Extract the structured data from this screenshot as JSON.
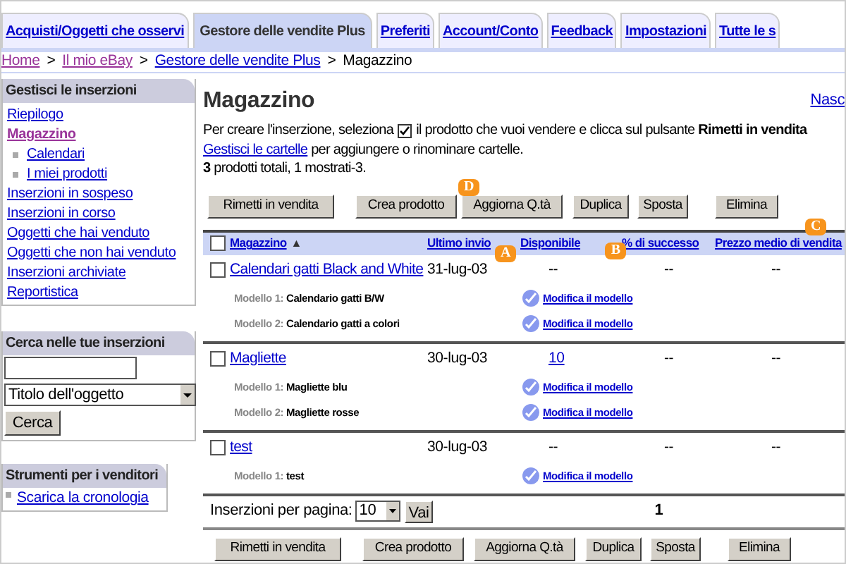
{
  "tabs": [
    {
      "label": "Acquisti/Oggetti che osservi",
      "selected": false
    },
    {
      "label": "Gestore delle vendite Plus",
      "selected": true
    },
    {
      "label": "Preferiti",
      "selected": false
    },
    {
      "label": "Account/Conto",
      "selected": false
    },
    {
      "label": "Feedback",
      "selected": false
    },
    {
      "label": "Impostazioni",
      "selected": false
    },
    {
      "label": "Tutte le s",
      "selected": false
    }
  ],
  "breadcrumb": {
    "links": [
      "Home",
      "Il mio eBay",
      "Gestore delle vendite Plus"
    ],
    "current": "Magazzino",
    "separator": ">"
  },
  "sidebar": {
    "manage": {
      "title": "Gestisci le inserzioni",
      "items": [
        {
          "label": "Riepilogo",
          "selected": false
        },
        {
          "label": "Magazzino",
          "selected": true,
          "children": [
            {
              "label": "Calendari",
              "selected": false
            },
            {
              "label": "I miei prodotti",
              "selected": false
            }
          ]
        },
        {
          "label": "Inserzioni in sospeso",
          "selected": false
        },
        {
          "label": "Inserzioni in corso",
          "selected": false
        },
        {
          "label": "Oggetti che hai venduto",
          "selected": false
        },
        {
          "label": "Oggetti che non hai venduto",
          "selected": false
        },
        {
          "label": "Inserzioni archiviate",
          "selected": false
        },
        {
          "label": "Reportistica",
          "selected": false
        }
      ]
    },
    "search": {
      "title": "Cerca nelle tue inserzioni",
      "select_value": "Titolo dell'oggetto",
      "button": "Cerca"
    },
    "tools": {
      "title": "Strumenti per i venditori",
      "items": [
        "Scarica la cronologia"
      ]
    }
  },
  "main": {
    "title": "Magazzino",
    "hide_link": "Nasc",
    "intro_start": "Per creare l'inserzione, seleziona",
    "intro_end": "il prodotto che vuoi vendere e clicca sul pulsante **Rimetti in vendita**",
    "folders_link": "Gestisci le cartelle",
    "folders_text": "per aggiungere o rinominare cartelle.",
    "count": "**3** prodotti totali, 1 mostrati-3.",
    "buttons": [
      {
        "label": "Rimetti in vendita"
      },
      {
        "label": "Crea prodotto"
      },
      {
        "label": "Aggiorna Q.tà",
        "callout": "D"
      },
      {
        "label": "Duplica"
      },
      {
        "label": "Sposta"
      },
      {
        "label": "Elimina"
      }
    ],
    "columns": [
      {
        "label": "Magazzino",
        "sort_icon": "▲"
      },
      {
        "label": "Ultimo invio",
        "callout": "A"
      },
      {
        "label": "Disponibile"
      },
      {
        "label": "% di successo",
        "callout": "B"
      },
      {
        "label": "Prezzo medio di vendita",
        "callout": "C"
      }
    ],
    "header_checked": false,
    "products": [
      {
        "name": "Calendari gatti Black and White",
        "checked": false,
        "date": "31-lug-03",
        "available": {
          "text": "--",
          "link": false
        },
        "success": "--",
        "price": "--",
        "models": [
          {
            "label": "Modello 1:",
            "name": "Calendario gatti B/W",
            "action": "Modifica il modello"
          },
          {
            "label": "Modello 2:",
            "name": "Calendario gatti a colori",
            "action": "Modifica il modello"
          }
        ]
      },
      {
        "name": "Magliette",
        "checked": false,
        "date": "30-lug-03",
        "available": {
          "text": "10",
          "link": true
        },
        "success": "--",
        "price": "--",
        "models": [
          {
            "label": "Modello 1:",
            "name": "Magliette blu",
            "action": "Modifica il modello"
          },
          {
            "label": "Modello 2:",
            "name": "Magliette rosse",
            "action": "Modifica il modello"
          }
        ]
      },
      {
        "name": "test",
        "checked": false,
        "date": "30-lug-03",
        "available": {
          "text": "--",
          "link": false
        },
        "success": "--",
        "price": "--",
        "models": [
          {
            "label": "Modello 1:",
            "name": "test",
            "action": "Modifica il modello"
          }
        ]
      }
    ],
    "per_page": {
      "label": "Inserzioni per pagina:",
      "value": "10",
      "button": "Vai",
      "page": "1"
    },
    "bottom_buttons": [
      {
        "label": "Rimetti in vendita"
      },
      {
        "label": "Crea prodotto"
      },
      {
        "label": "Aggiorna Q.tà"
      },
      {
        "label": "Duplica"
      },
      {
        "label": "Sposta"
      },
      {
        "label": "Elimina"
      }
    ]
  }
}
